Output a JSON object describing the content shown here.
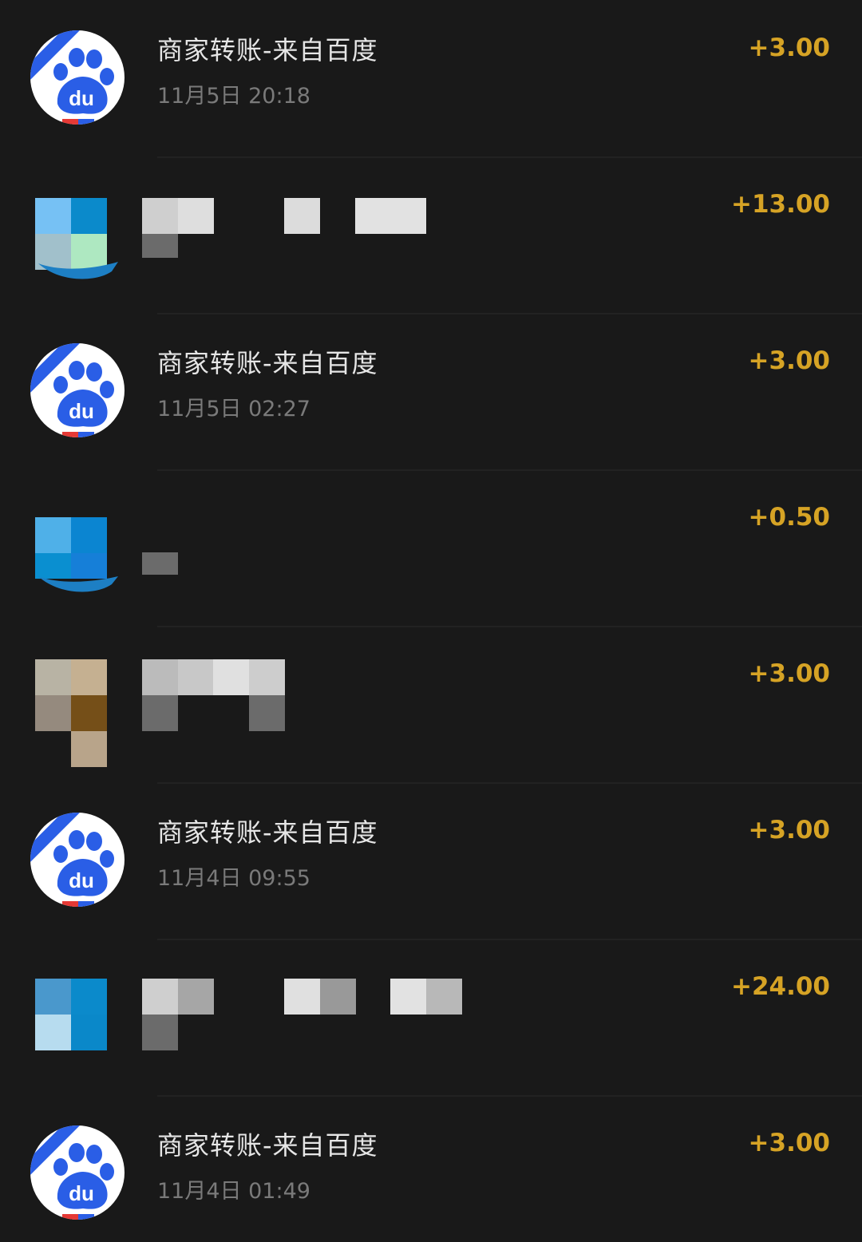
{
  "transactions": [
    {
      "title": "商家转账-来自百度",
      "time": "11月5日 20:18",
      "amount": "+3.00",
      "avatar": "baidu-icon"
    },
    {
      "title": "",
      "time": "",
      "amount": "+13.00",
      "avatar": "pixelated-avatar"
    },
    {
      "title": "商家转账-来自百度",
      "time": "11月5日 02:27",
      "amount": "+3.00",
      "avatar": "baidu-icon"
    },
    {
      "title": "",
      "time": "",
      "amount": "+0.50",
      "avatar": "pixelated-avatar"
    },
    {
      "title": "",
      "time": "",
      "amount": "+3.00",
      "avatar": "pixelated-avatar"
    },
    {
      "title": "商家转账-来自百度",
      "time": "11月4日 09:55",
      "amount": "+3.00",
      "avatar": "baidu-icon"
    },
    {
      "title": "",
      "time": "",
      "amount": "+24.00",
      "avatar": "pixelated-avatar"
    },
    {
      "title": "商家转账-来自百度",
      "time": "11月4日 01:49",
      "amount": "+3.00",
      "avatar": "baidu-icon"
    }
  ],
  "colors": {
    "background": "#191919",
    "title": "#e6e6e6",
    "time": "#7a7a7a",
    "amount": "#d6a325",
    "baidu_blue": "#2a5ee6"
  }
}
